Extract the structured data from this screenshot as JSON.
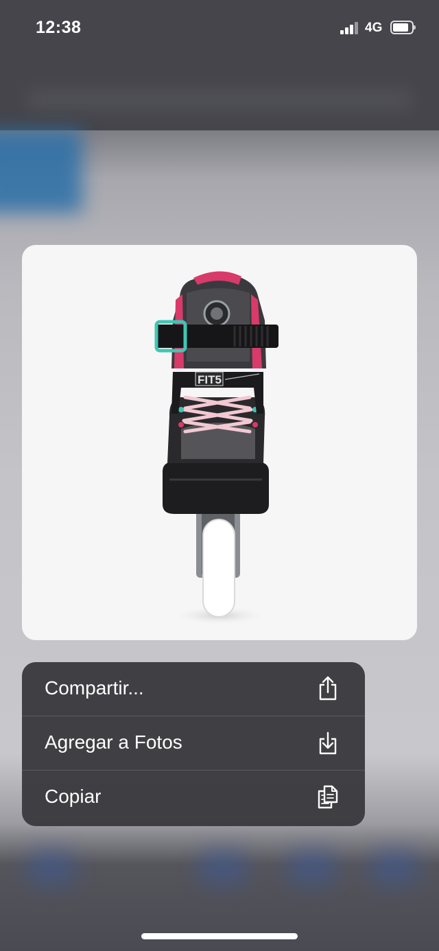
{
  "status_bar": {
    "time": "12:38",
    "network": "4G"
  },
  "preview": {
    "image_subject": "inline-skate",
    "brand_mark": "FIT5"
  },
  "menu": {
    "items": [
      {
        "label": "Compartir...",
        "icon": "share-icon"
      },
      {
        "label": "Agregar a Fotos",
        "icon": "save-to-photos-icon"
      },
      {
        "label": "Copiar",
        "icon": "copy-icon"
      }
    ]
  },
  "colors": {
    "menu_background": "#3a3a3e",
    "card_background": "#f6f6f6",
    "skate_accent_pink": "#d83a6a",
    "skate_accent_teal": "#3fc6b4"
  }
}
